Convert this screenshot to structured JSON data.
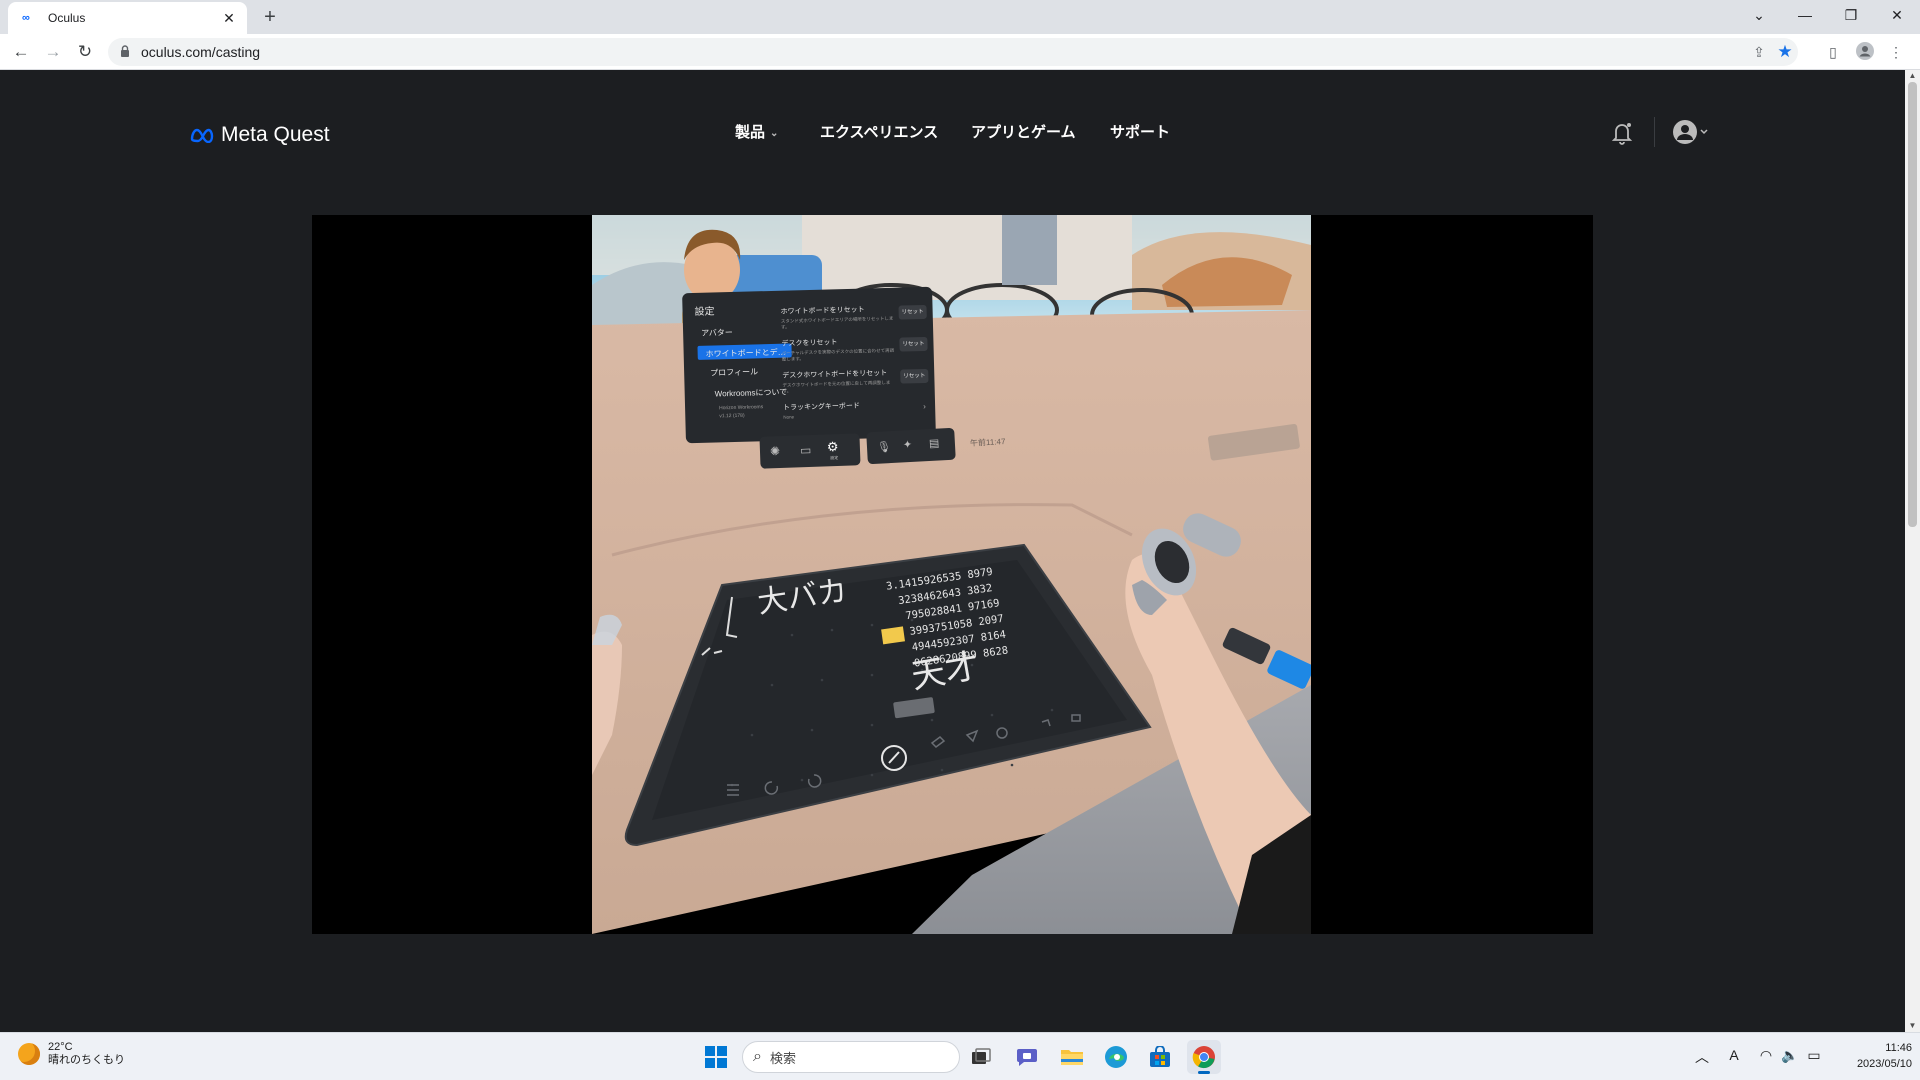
{
  "browser": {
    "tab_title": "Oculus",
    "favicon": "meta-logo-icon",
    "url": "oculus.com/casting",
    "window_controls": [
      "chevron-down-icon",
      "minimize-icon",
      "restore-icon",
      "close-icon"
    ]
  },
  "site": {
    "logo_text": "Meta Quest",
    "nav": [
      {
        "label": "製品",
        "has_dropdown": true
      },
      {
        "label": "エクスペリエンス",
        "has_dropdown": false
      },
      {
        "label": "アプリとゲーム",
        "has_dropdown": false
      },
      {
        "label": "サポート",
        "has_dropdown": false
      }
    ],
    "brand_color": "#0866ff"
  },
  "cast": {
    "settings_panel": {
      "title": "設定",
      "menu": [
        "アバター",
        "ホワイトボードとデ…",
        "プロフィール",
        "Workroomsについて"
      ],
      "version_line1": "Horizon Workrooms",
      "version_line2": "v1.12 (178)",
      "items": [
        {
          "title": "ホワイトボードをリセット",
          "desc": "スタンド式ホワイトボードエリアの場所をリセットします。",
          "button": "リセット"
        },
        {
          "title": "デスクをリセット",
          "desc": "バーチャルデスクを実際のデスクの位置に合わせて再調整します。",
          "button": "リセット"
        },
        {
          "title": "デスクホワイトボードをリセット",
          "desc": "デスクホワイトボードを元の位置に戻して再調整します。",
          "button": "リセット"
        },
        {
          "title": "トラッキングキーボード",
          "desc": "None",
          "button": ""
        }
      ]
    },
    "dock_time": "午前11:47",
    "dock_settings_label": "設定",
    "whiteboard_text": "大バカ",
    "whiteboard_digits": [
      "3.1415926535 8979",
      "3238462643 3832",
      "795028841 97169",
      "3993751058 2097",
      "4944592307 8164",
      "0628620899 8628"
    ],
    "whiteboard_text2": "天才"
  },
  "taskbar": {
    "temperature": "22°C",
    "weather": "晴れのちくもり",
    "search_placeholder": "検索",
    "apps": [
      "windows-start-icon",
      "search-icon",
      "task-view-icon",
      "teams-chat-icon",
      "file-explorer-icon",
      "edge-icon",
      "store-icon",
      "chrome-icon"
    ],
    "time": "11:46",
    "date": "2023/05/10"
  }
}
